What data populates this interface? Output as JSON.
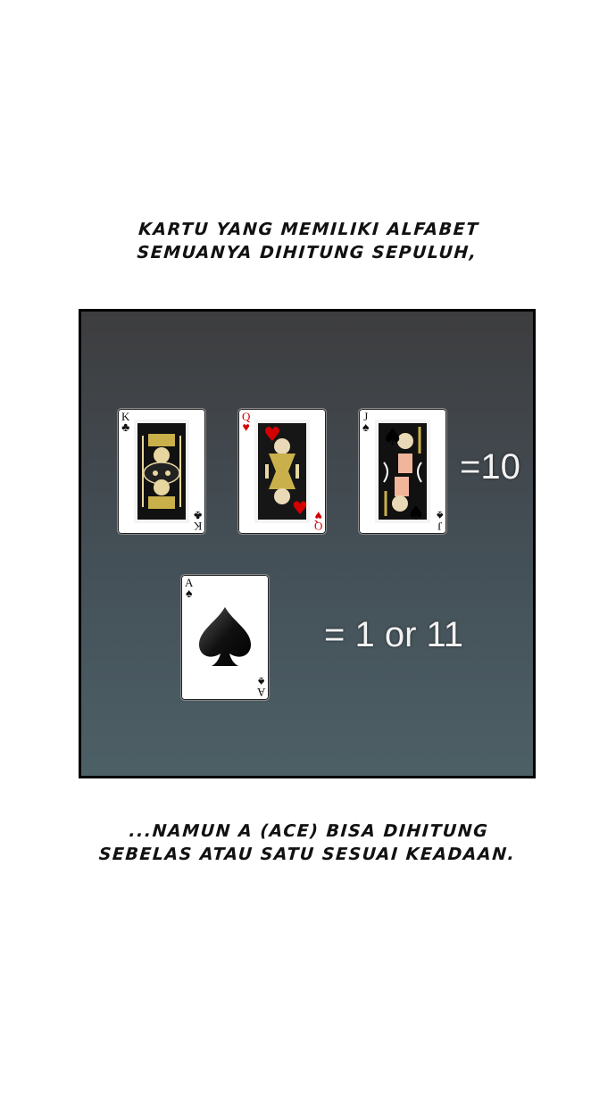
{
  "caption_top": {
    "line1": "KARTU YANG MEMILIKI ALFABET",
    "line2": "SEMUANYA DIHITUNG SEPULUH,"
  },
  "panel": {
    "face_cards": [
      {
        "rank": "K",
        "suit": "clubs",
        "suit_glyph": "♣",
        "color": "#000000"
      },
      {
        "rank": "Q",
        "suit": "hearts",
        "suit_glyph": "♥",
        "color": "#d40000"
      },
      {
        "rank": "J",
        "suit": "spades",
        "suit_glyph": "♠",
        "color": "#000000"
      }
    ],
    "face_equation": "=10",
    "ace_card": {
      "rank": "A",
      "suit": "spades",
      "suit_glyph": "♠",
      "color": "#000000"
    },
    "ace_equation": "= 1 or 11"
  },
  "caption_bottom": {
    "line1": "...NAMUN A (ACE) BISA DIHITUNG",
    "line2": "SEBELAS ATAU SATU SESUAI KEADAAN."
  }
}
